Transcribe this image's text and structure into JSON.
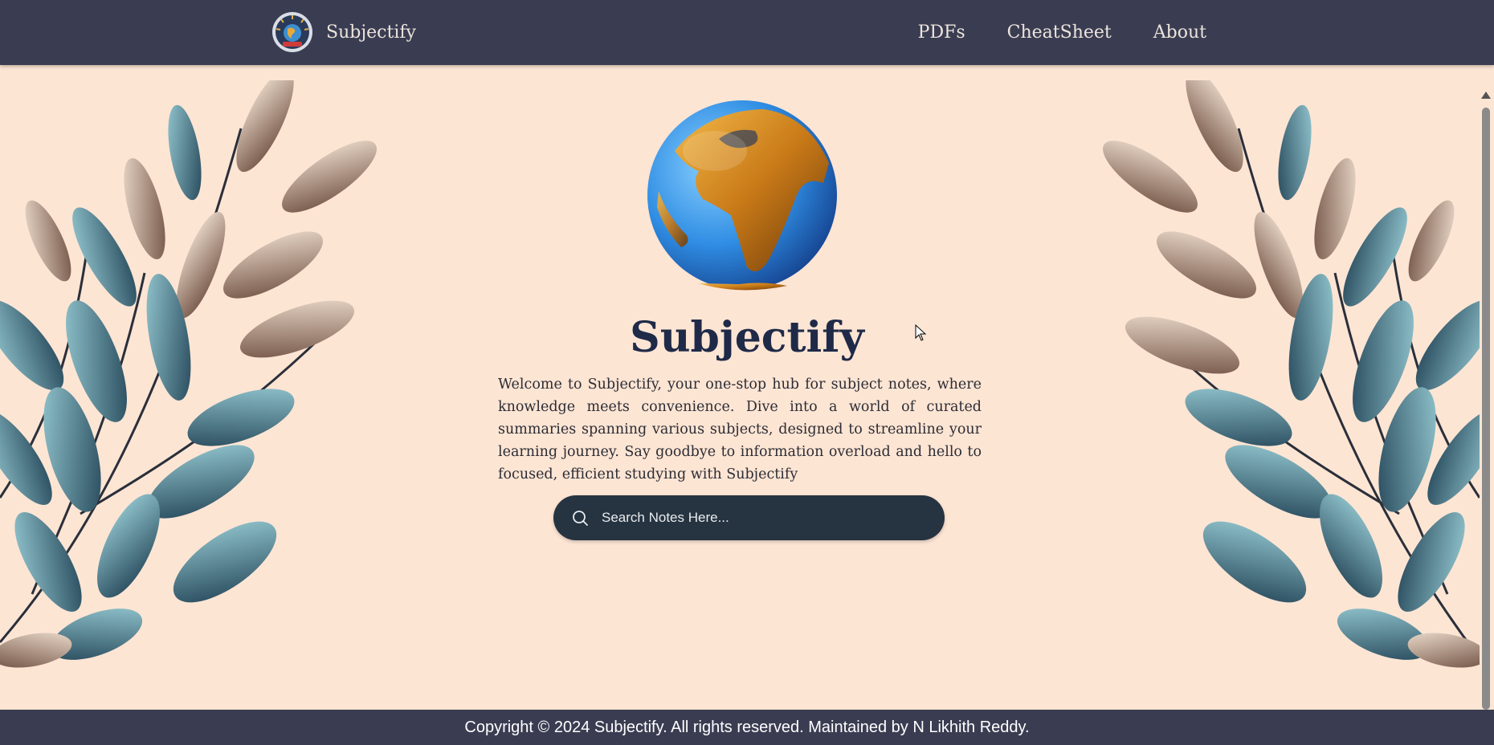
{
  "navbar": {
    "brand": {
      "name": "Subjectify",
      "logo_icon": "globe-logo-icon"
    },
    "links": [
      {
        "label": "PDFs"
      },
      {
        "label": "CheatSheet"
      },
      {
        "label": "About"
      }
    ]
  },
  "hero": {
    "image_icon": "earth-globe-icon",
    "title": "Subjectify",
    "description": "Welcome to Subjectify, your one-stop hub for subject notes, where knowledge meets convenience. Dive into a world of curated summaries spanning various subjects, designed to streamline your learning journey. Say goodbye to information overload and hello to focused, efficient studying with Subjectify"
  },
  "search": {
    "placeholder": "Search Notes Here...",
    "value": "",
    "icon": "search-icon"
  },
  "footer": {
    "text": "Copyright © 2024 Subjectify. All rights reserved. Maintained by N Likhith Reddy."
  },
  "colors": {
    "navbar_bg": "#3a3d52",
    "page_bg": "#fde5d4",
    "title": "#1f2a48",
    "search_bg": "#263340"
  }
}
